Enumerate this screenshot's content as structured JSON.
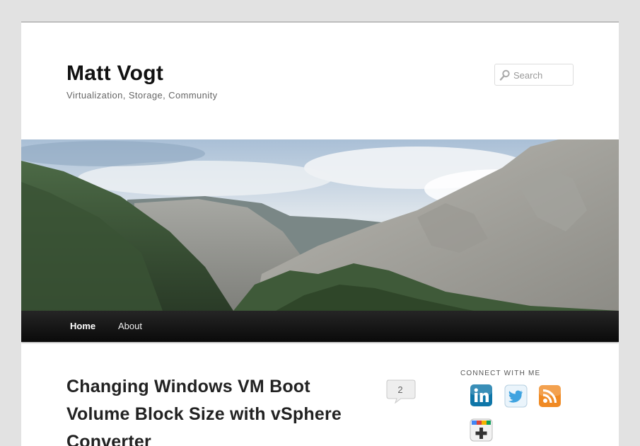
{
  "site": {
    "title": "Matt Vogt",
    "description": "Virtualization, Storage, Community"
  },
  "search": {
    "placeholder": "Search",
    "icon": "search-icon"
  },
  "banner": {
    "icon": "mountain-landscape-image"
  },
  "nav": {
    "items": [
      {
        "label": "Home"
      },
      {
        "label": "About"
      }
    ]
  },
  "post": {
    "title": "Changing Windows VM Boot Volume Block Size with vSphere Converter",
    "comment_count": "2"
  },
  "sidebar": {
    "widget_title": "CONNECT WITH ME",
    "icons": [
      "linkedin-icon",
      "twitter-icon",
      "rss-icon",
      "google-plus-icon"
    ]
  },
  "colors": {
    "background": "#e2e2e2",
    "nav_bar": "#1a1a1a",
    "title": "#111111",
    "linkedin": "#0e76a8",
    "twitter": "#55acee",
    "rss": "#f08a24"
  }
}
